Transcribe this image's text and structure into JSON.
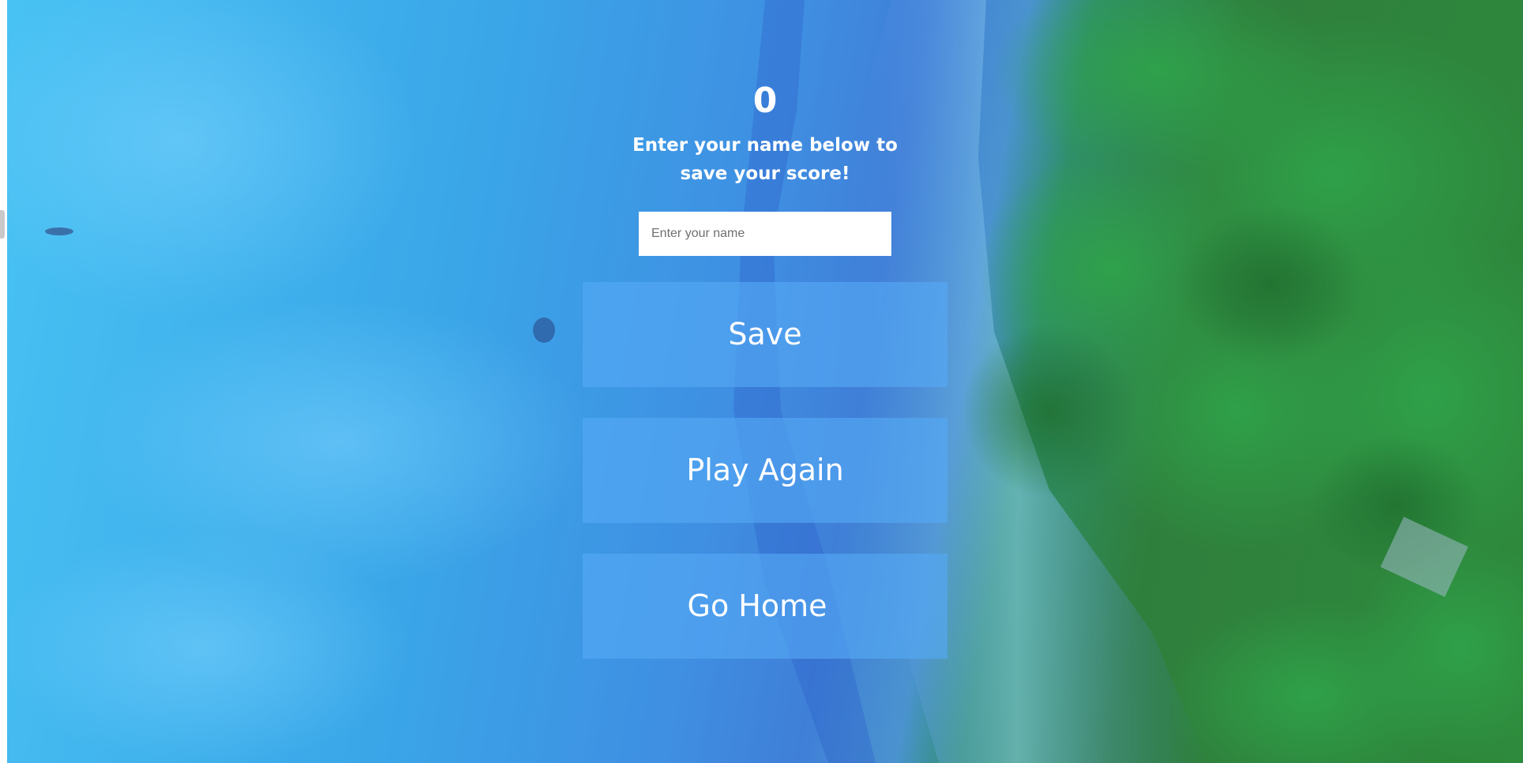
{
  "end_screen": {
    "score": "0",
    "prompt": "Enter your name below to save your score!",
    "name_input": {
      "value": "",
      "placeholder": "Enter your name"
    },
    "buttons": {
      "save": "Save",
      "play_again": "Play Again",
      "go_home": "Go Home"
    }
  },
  "background": {
    "description_colors": {
      "water": "#48c2f3",
      "shore": "#3f7fd8",
      "forest": "#2f8a3c"
    }
  }
}
